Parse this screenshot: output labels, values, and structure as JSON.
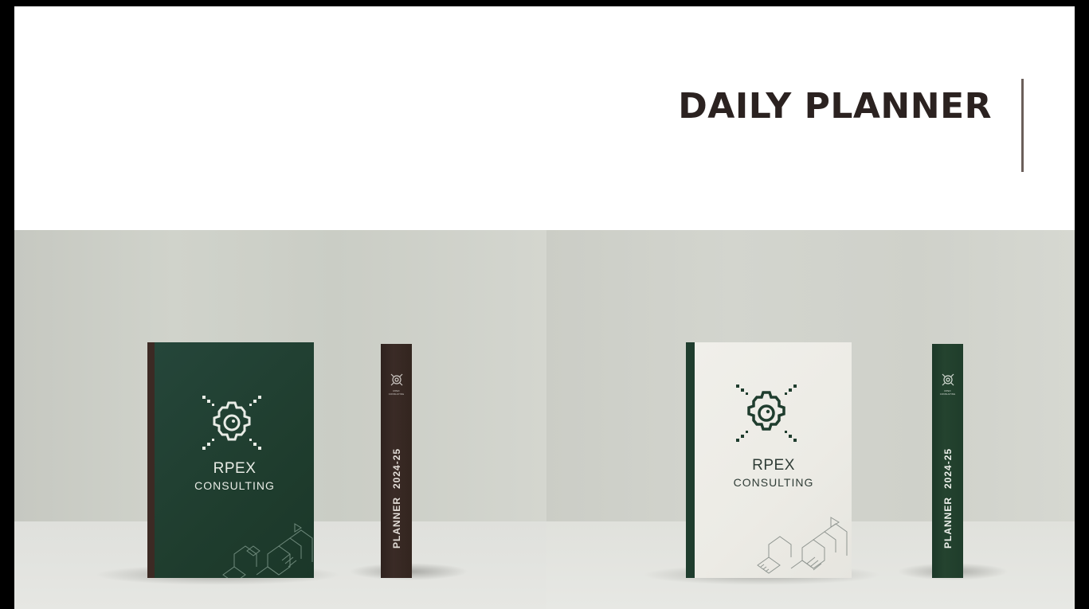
{
  "header": {
    "title": "DAILY PLANNER"
  },
  "left_photo": {
    "book_brand": "RPEX",
    "book_brand_sub": "CONSULTING",
    "spine_title": "PLANNER",
    "spine_year": "2024-25",
    "cover_color": "#1f3d2e",
    "binding_color": "#3c2a24",
    "spine_color": "#3a2b26"
  },
  "right_photo": {
    "book_brand": "RPEX",
    "book_brand_sub": "CONSULTING",
    "spine_title": "PLANNER",
    "spine_year": "2024-25",
    "cover_color": "#ecebe5",
    "binding_color": "#1f3d2e",
    "spine_color": "#24432f"
  },
  "icons": {
    "logo": "gear-icon"
  }
}
